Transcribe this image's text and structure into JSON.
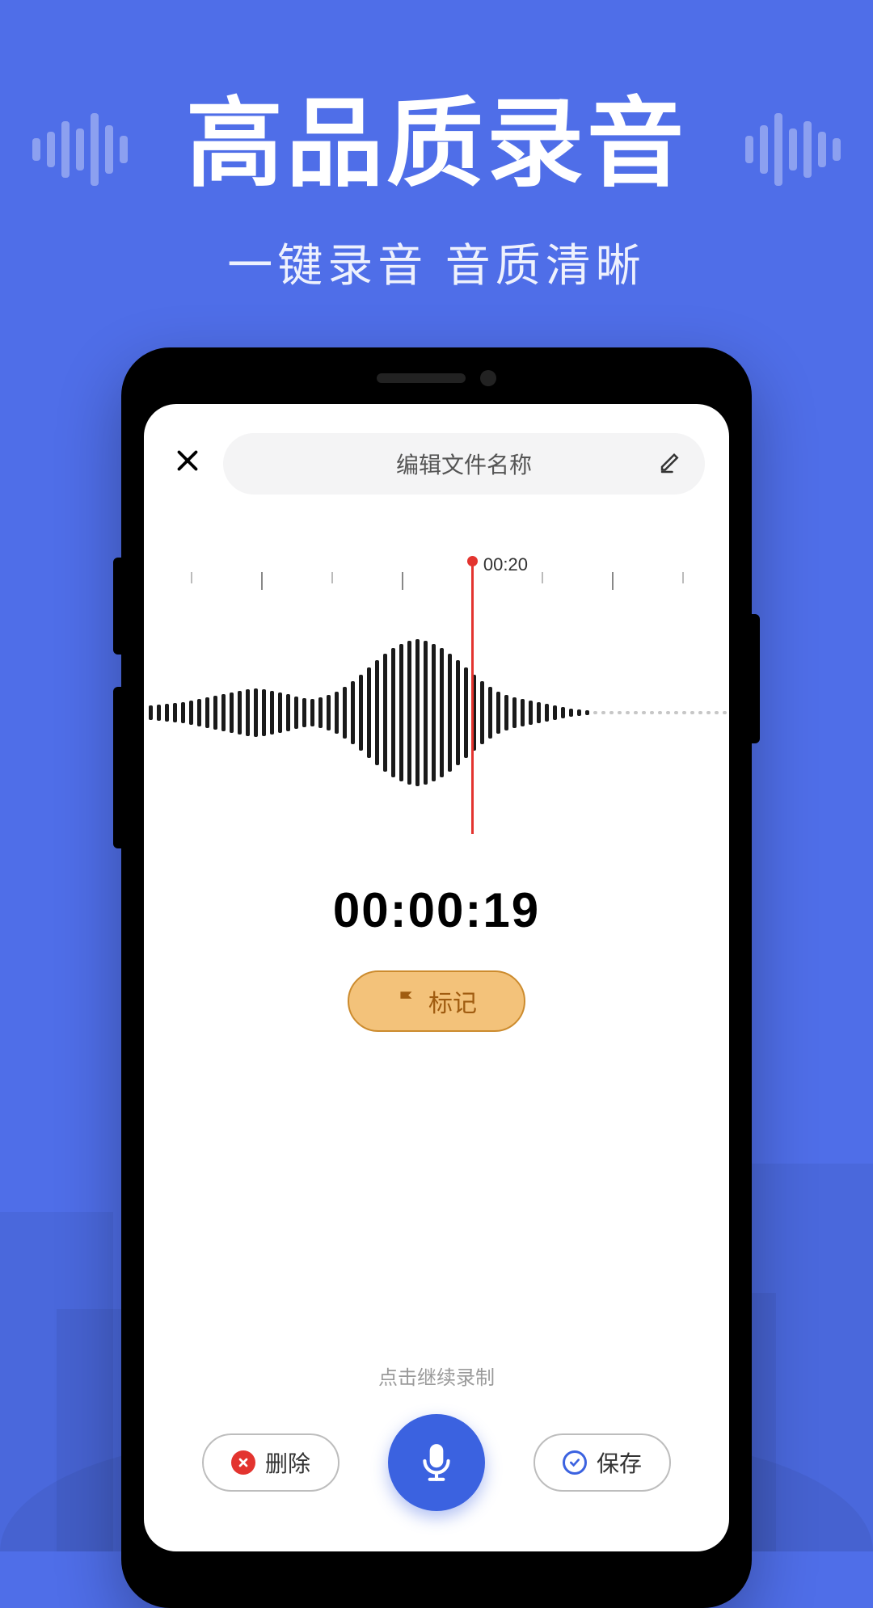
{
  "hero": {
    "title": "高品质录音",
    "subtitle": "一键录音 音质清晰"
  },
  "app": {
    "filename_placeholder": "编辑文件名称",
    "waveform_time_label": "00:20",
    "timer": "00:00:19",
    "mark_label": "标记",
    "resume_hint": "点击继续录制",
    "delete_label": "删除",
    "save_label": "保存"
  },
  "colors": {
    "primary": "#3b62e0",
    "accent": "#f3c27a",
    "danger": "#e3342f"
  }
}
